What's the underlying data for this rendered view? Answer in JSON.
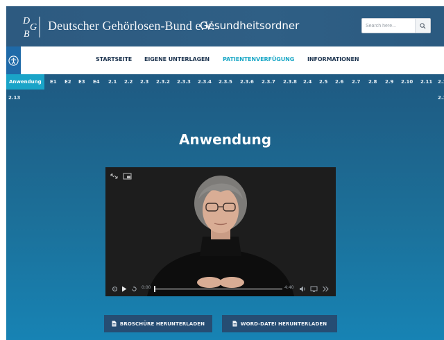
{
  "header": {
    "org_name": "Deutscher Gehörlosen-Bund e.V.",
    "site_title": "Gesundheitsordner",
    "search_placeholder": "Search here...",
    "logo_icon": "dgb-logo-icon"
  },
  "nav": {
    "items": [
      {
        "label": "STARTSEITE",
        "active": false
      },
      {
        "label": "EIGENE UNTERLAGEN",
        "active": false
      },
      {
        "label": "PATIENTENVERFÜGUNG",
        "active": true
      },
      {
        "label": "INFORMATIONEN",
        "active": false
      }
    ],
    "accessibility_icon": "accessibility-icon"
  },
  "tabs": {
    "row1": [
      "Anwendung",
      "E1",
      "E2",
      "E3",
      "E4",
      "2.1",
      "2.2",
      "2.3",
      "2.3.2",
      "2.3.3",
      "2.3.4",
      "2.3.5",
      "2.3.6",
      "2.3.7",
      "2.3.8",
      "2.4",
      "2.5",
      "2.6",
      "2.7",
      "2.8",
      "2.9",
      "2.10",
      "2.11",
      "2.1"
    ],
    "row2_left": "2.13",
    "row2_right": "2.1",
    "active": "Anwendung"
  },
  "main": {
    "heading": "Anwendung"
  },
  "video": {
    "current_time": "0:00",
    "duration": "4:40",
    "progress": 0.0
  },
  "buttons": {
    "brochure": "BROSCHÜRE HERUNTERLADEN",
    "word": "WORD-DATEI HERUNTERLADEN"
  },
  "colors": {
    "accent": "#1aa4c8",
    "nav_active": "#1aa7c6",
    "button_bg": "#264d73"
  }
}
